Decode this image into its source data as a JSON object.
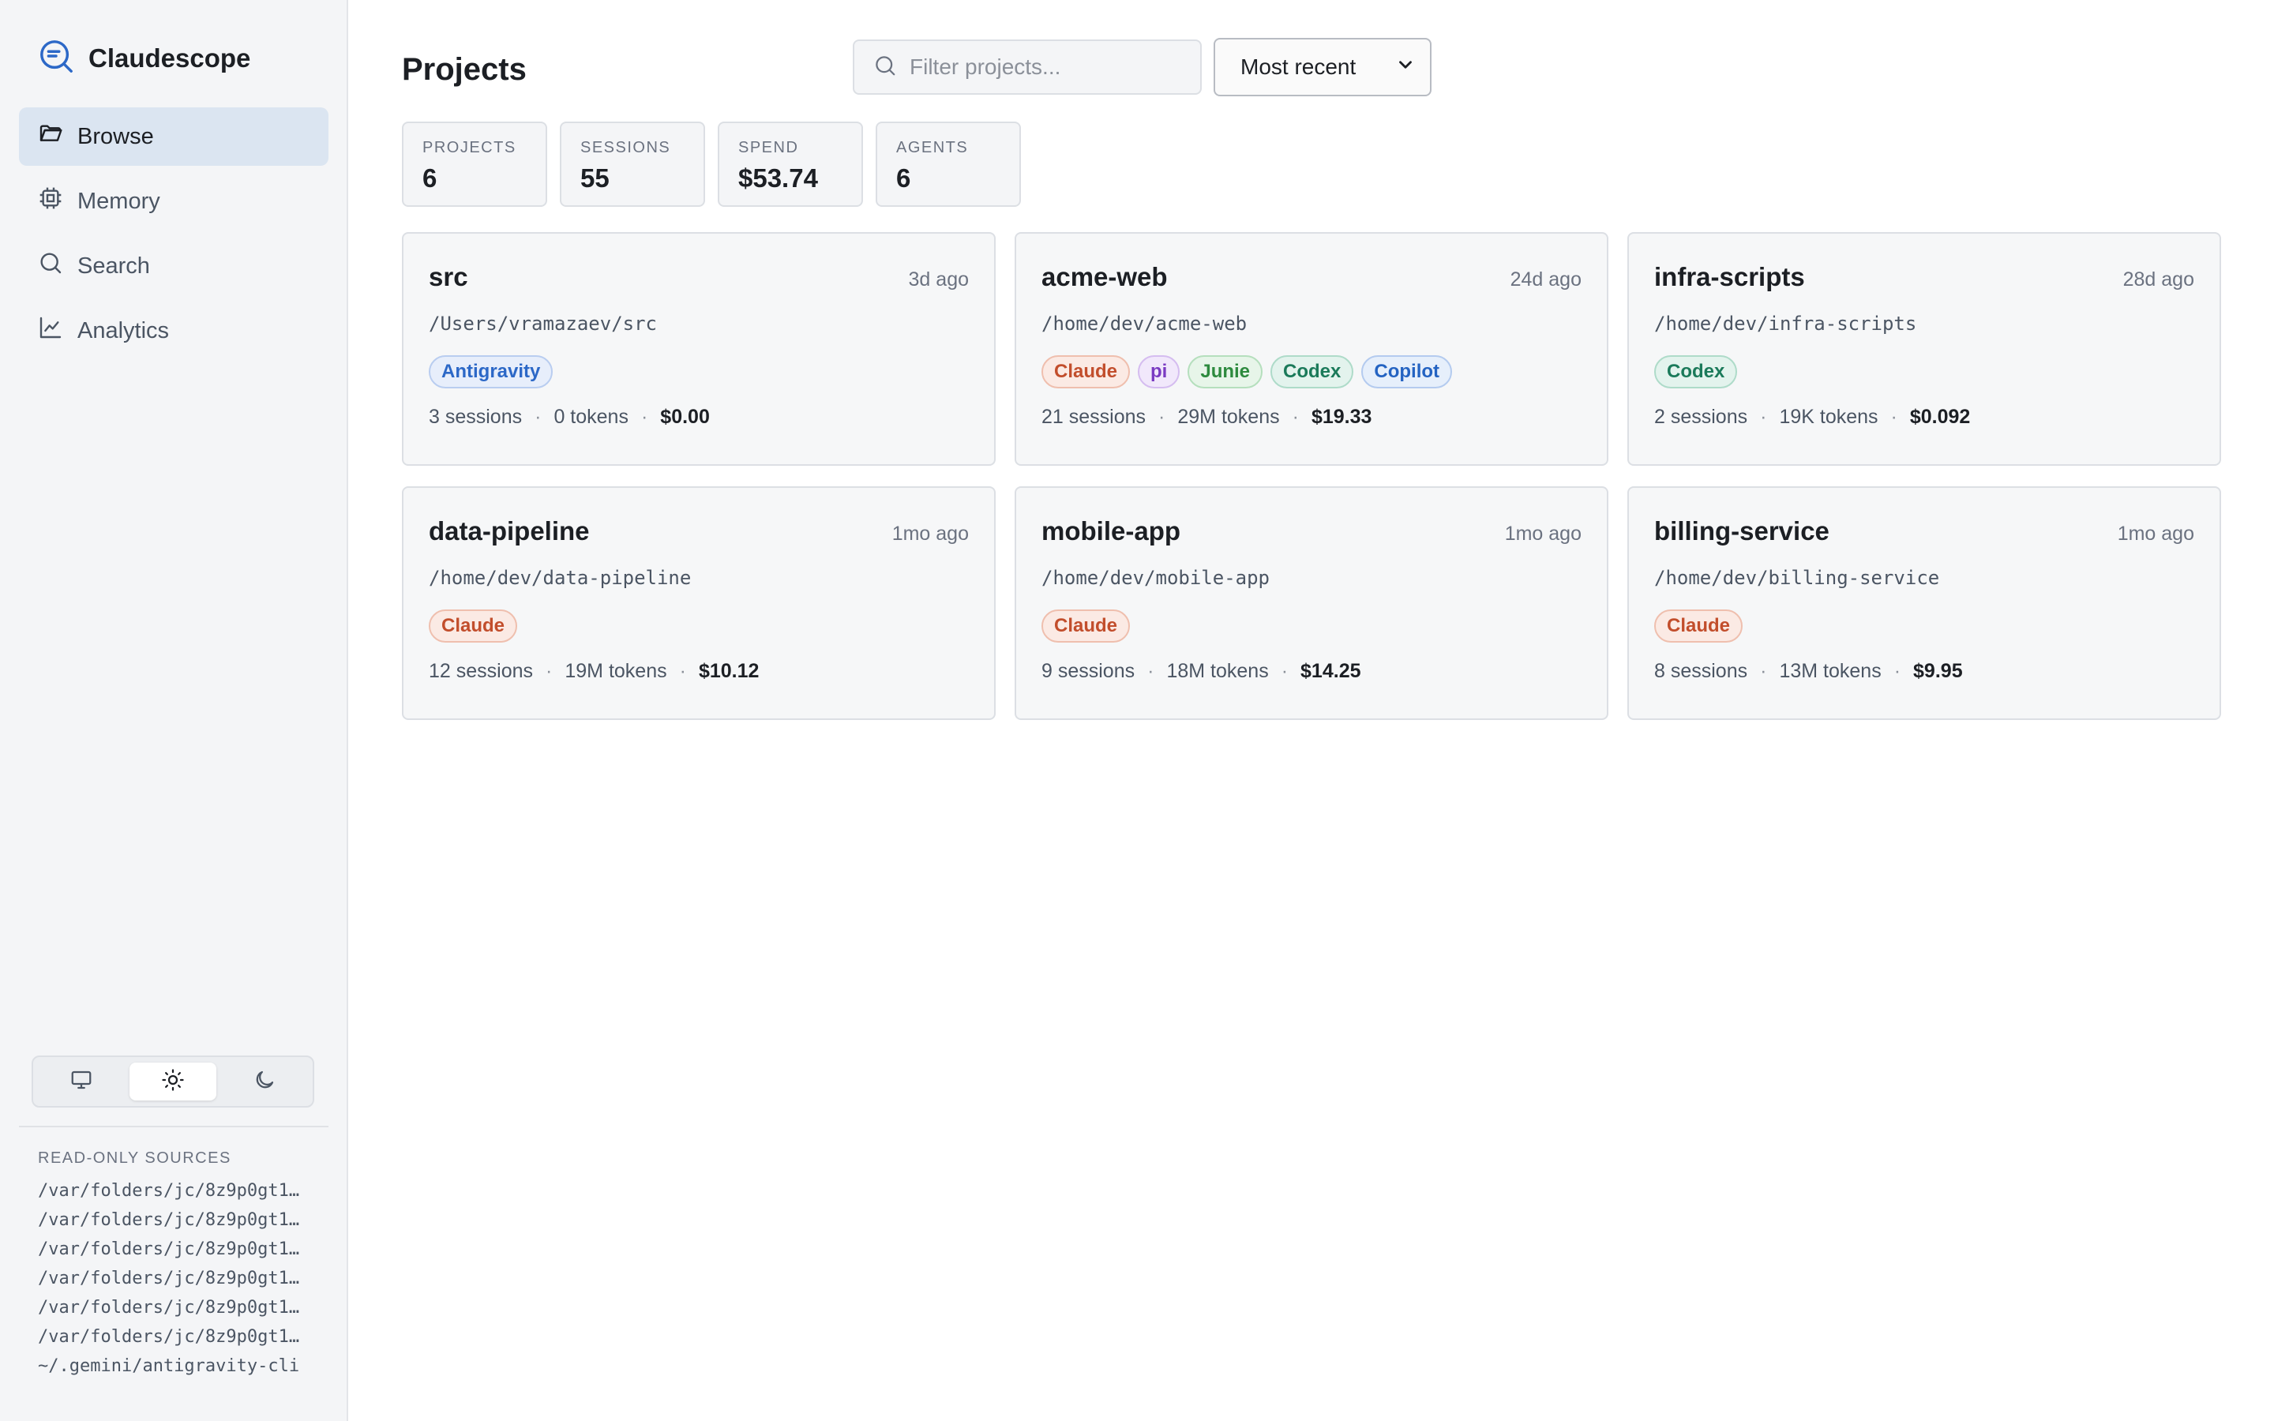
{
  "app": {
    "name": "Claudescope"
  },
  "nav": [
    {
      "label": "Browse",
      "icon": "folder-icon",
      "active": true
    },
    {
      "label": "Memory",
      "icon": "chip-icon",
      "active": false
    },
    {
      "label": "Search",
      "icon": "search-icon",
      "active": false
    },
    {
      "label": "Analytics",
      "icon": "line-chart-icon",
      "active": false
    }
  ],
  "theme": {
    "options": [
      "system",
      "light",
      "dark"
    ],
    "selected": "light"
  },
  "sources": {
    "label": "READ-ONLY SOURCES",
    "items": [
      "/var/folders/jc/8z9p0gt1…",
      "/var/folders/jc/8z9p0gt1…",
      "/var/folders/jc/8z9p0gt1…",
      "/var/folders/jc/8z9p0gt1…",
      "/var/folders/jc/8z9p0gt1…",
      "/var/folders/jc/8z9p0gt1…",
      "~/.gemini/antigravity-cli"
    ]
  },
  "page": {
    "title": "Projects"
  },
  "filter": {
    "placeholder": "Filter projects..."
  },
  "sort": {
    "selected": "Most recent"
  },
  "stats": [
    {
      "label": "PROJECTS",
      "value": "6"
    },
    {
      "label": "SESSIONS",
      "value": "55"
    },
    {
      "label": "SPEND",
      "value": "$53.74"
    },
    {
      "label": "AGENTS",
      "value": "6"
    }
  ],
  "projects": [
    {
      "name": "src",
      "time": "3d ago",
      "path": "/Users/vramazaev/src",
      "tags": [
        "Antigravity"
      ],
      "sessions": "3 sessions",
      "tokens": "0 tokens",
      "cost": "$0.00"
    },
    {
      "name": "acme-web",
      "time": "24d ago",
      "path": "/home/dev/acme-web",
      "tags": [
        "Claude",
        "pi",
        "Junie",
        "Codex",
        "Copilot"
      ],
      "sessions": "21 sessions",
      "tokens": "29M tokens",
      "cost": "$19.33"
    },
    {
      "name": "infra-scripts",
      "time": "28d ago",
      "path": "/home/dev/infra-scripts",
      "tags": [
        "Codex"
      ],
      "sessions": "2 sessions",
      "tokens": "19K tokens",
      "cost": "$0.092"
    },
    {
      "name": "data-pipeline",
      "time": "1mo ago",
      "path": "/home/dev/data-pipeline",
      "tags": [
        "Claude"
      ],
      "sessions": "12 sessions",
      "tokens": "19M tokens",
      "cost": "$10.12"
    },
    {
      "name": "mobile-app",
      "time": "1mo ago",
      "path": "/home/dev/mobile-app",
      "tags": [
        "Claude"
      ],
      "sessions": "9 sessions",
      "tokens": "18M tokens",
      "cost": "$14.25"
    },
    {
      "name": "billing-service",
      "time": "1mo ago",
      "path": "/home/dev/billing-service",
      "tags": [
        "Claude"
      ],
      "sessions": "8 sessions",
      "tokens": "13M tokens",
      "cost": "$9.95"
    }
  ],
  "meta_separator": "·",
  "colors": {
    "accent": "#2c68c7",
    "active_nav_bg": "#dbe5f1"
  }
}
